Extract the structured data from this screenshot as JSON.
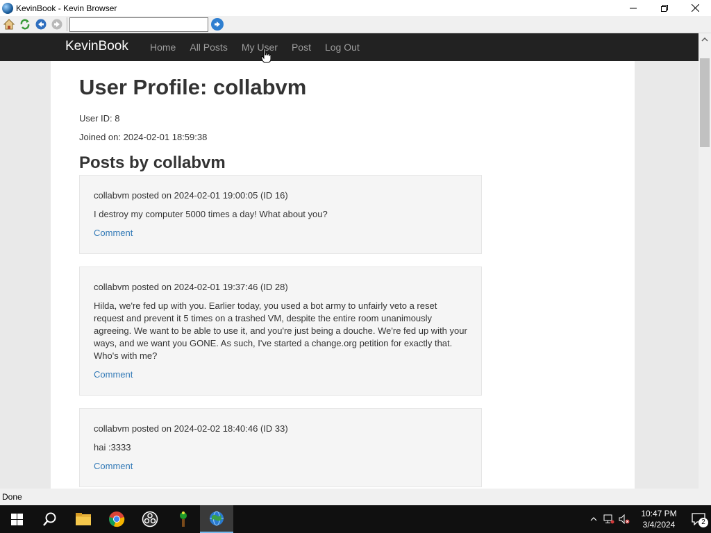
{
  "window": {
    "title": "KevinBook - Kevin Browser"
  },
  "toolbar": {
    "address_value": ""
  },
  "navbar": {
    "brand": "KevinBook",
    "links": [
      "Home",
      "All Posts",
      "My User",
      "Post",
      "Log Out"
    ]
  },
  "profile": {
    "title": "User Profile: collabvm",
    "user_id": "User ID: 8",
    "joined": "Joined on: 2024-02-01 18:59:38",
    "posts_heading": "Posts by collabvm"
  },
  "posts": [
    {
      "header": "collabvm posted on 2024-02-01 19:00:05 (ID 16)",
      "body": "I destroy my computer 5000 times a day! What about you?",
      "comment": "Comment"
    },
    {
      "header": "collabvm posted on 2024-02-01 19:37:46 (ID 28)",
      "body": "Hilda, we're fed up with you. Earlier today, you used a bot army to unfairly veto a reset request and prevent it 5 times on a trashed VM, despite the entire room unanimously agreeing. We want to be able to use it, and you're just being a douche. We're fed up with your ways, and we want you GONE. As such, I've started a change.org petition for exactly that. Who's with me?",
      "comment": "Comment"
    },
    {
      "header": "collabvm posted on 2024-02-02 18:40:46 (ID 33)",
      "body": "hai :3333",
      "comment": "Comment"
    }
  ],
  "statusbar": {
    "text": "Done"
  },
  "taskbar": {
    "time": "10:47 PM",
    "date": "3/4/2024",
    "notification_count": "2"
  },
  "colors": {
    "navbar_bg": "#222222",
    "link": "#337ab7",
    "post_bg": "#f5f5f5"
  }
}
